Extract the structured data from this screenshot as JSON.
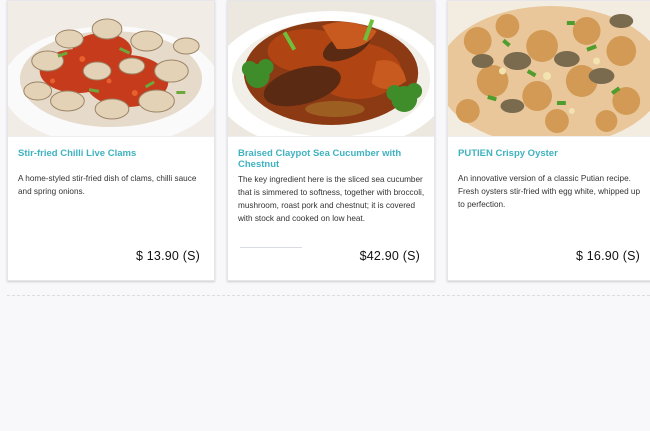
{
  "menu": {
    "items": [
      {
        "title": "Stir-fried Chilli Live Clams",
        "description": "A home-styled stir-fried dish of clams, chilli sauce and spring onions.",
        "price": "$ 13.90 (S)",
        "image_icon": "clams-dish-photo"
      },
      {
        "title": "Braised Claypot Sea Cucumber with Chestnut",
        "description": "The key ingredient here is the sliced sea cucumber that is simmered to softness, together with broccoli, mushroom, roast pork and chestnut; it is covered with stock and cooked on low heat.",
        "price": "$42.90 (S)",
        "image_icon": "sea-cucumber-dish-photo"
      },
      {
        "title": "PUTIEN Crispy Oyster",
        "description": "An innovative version of a classic Putian recipe. Fresh oysters stir-fried with egg white, whipped up to perfection.",
        "price": "$ 16.90 (S)",
        "image_icon": "oyster-dish-photo"
      }
    ]
  },
  "colors": {
    "title_teal": "#3fb2c0",
    "text_dark": "#333333",
    "price": "#111111",
    "background": "#f8f8fa"
  }
}
